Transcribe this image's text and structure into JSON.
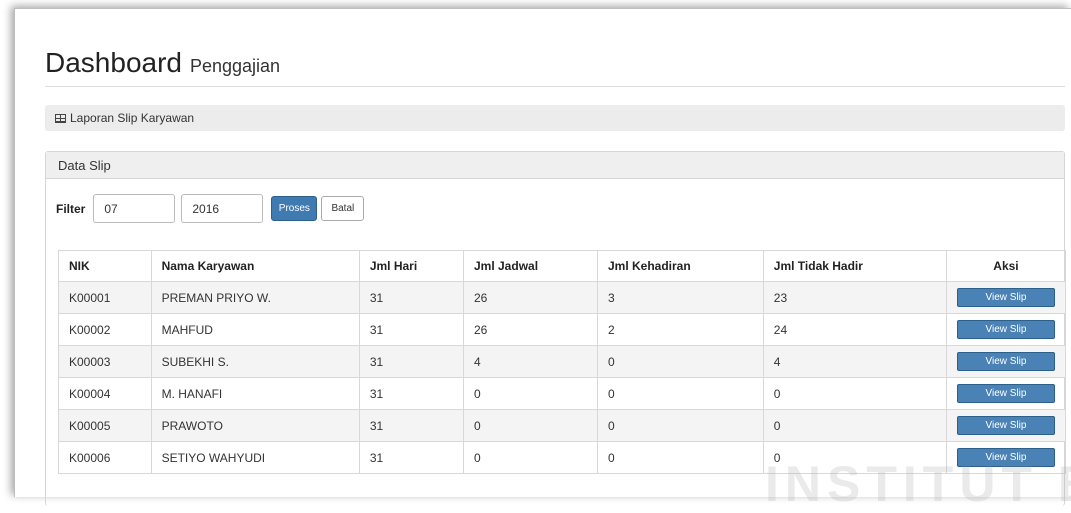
{
  "header": {
    "title": "Dashboard",
    "subtitle": "Penggajian"
  },
  "breadcrumb": {
    "label": "Laporan Slip Karyawan",
    "icon": "table-icon"
  },
  "panel": {
    "title": "Data Slip"
  },
  "filter": {
    "label": "Filter",
    "month_value": "07",
    "year_value": "2016",
    "proses_label": "Proses",
    "batal_label": "Batal"
  },
  "table": {
    "columns": [
      "NIK",
      "Nama Karyawan",
      "Jml Hari",
      "Jml Jadwal",
      "Jml Kehadiran",
      "Jml Tidak Hadir",
      "Aksi"
    ],
    "rows": [
      {
        "nik": "K00001",
        "nama": "PREMAN PRIYO W.",
        "hari": "31",
        "jadwal": "26",
        "hadir": "3",
        "tidak_hadir": "23",
        "aksi": "View Slip"
      },
      {
        "nik": "K00002",
        "nama": "MAHFUD",
        "hari": "31",
        "jadwal": "26",
        "hadir": "2",
        "tidak_hadir": "24",
        "aksi": "View Slip"
      },
      {
        "nik": "K00003",
        "nama": "SUBEKHI S.",
        "hari": "31",
        "jadwal": "4",
        "hadir": "0",
        "tidak_hadir": "4",
        "aksi": "View Slip"
      },
      {
        "nik": "K00004",
        "nama": "M. HANAFI",
        "hari": "31",
        "jadwal": "0",
        "hadir": "0",
        "tidak_hadir": "0",
        "aksi": "View Slip"
      },
      {
        "nik": "K00005",
        "nama": "PRAWOTO",
        "hari": "31",
        "jadwal": "0",
        "hadir": "0",
        "tidak_hadir": "0",
        "aksi": "View Slip"
      },
      {
        "nik": "K00006",
        "nama": "SETIYO WAHYUDI",
        "hari": "31",
        "jadwal": "0",
        "hadir": "0",
        "tidak_hadir": "0",
        "aksi": "View Slip"
      }
    ]
  },
  "watermark": "INSTITUT BISNIS",
  "colors": {
    "primary_button": "#3f7bb0",
    "view_button": "#4a82b5"
  }
}
